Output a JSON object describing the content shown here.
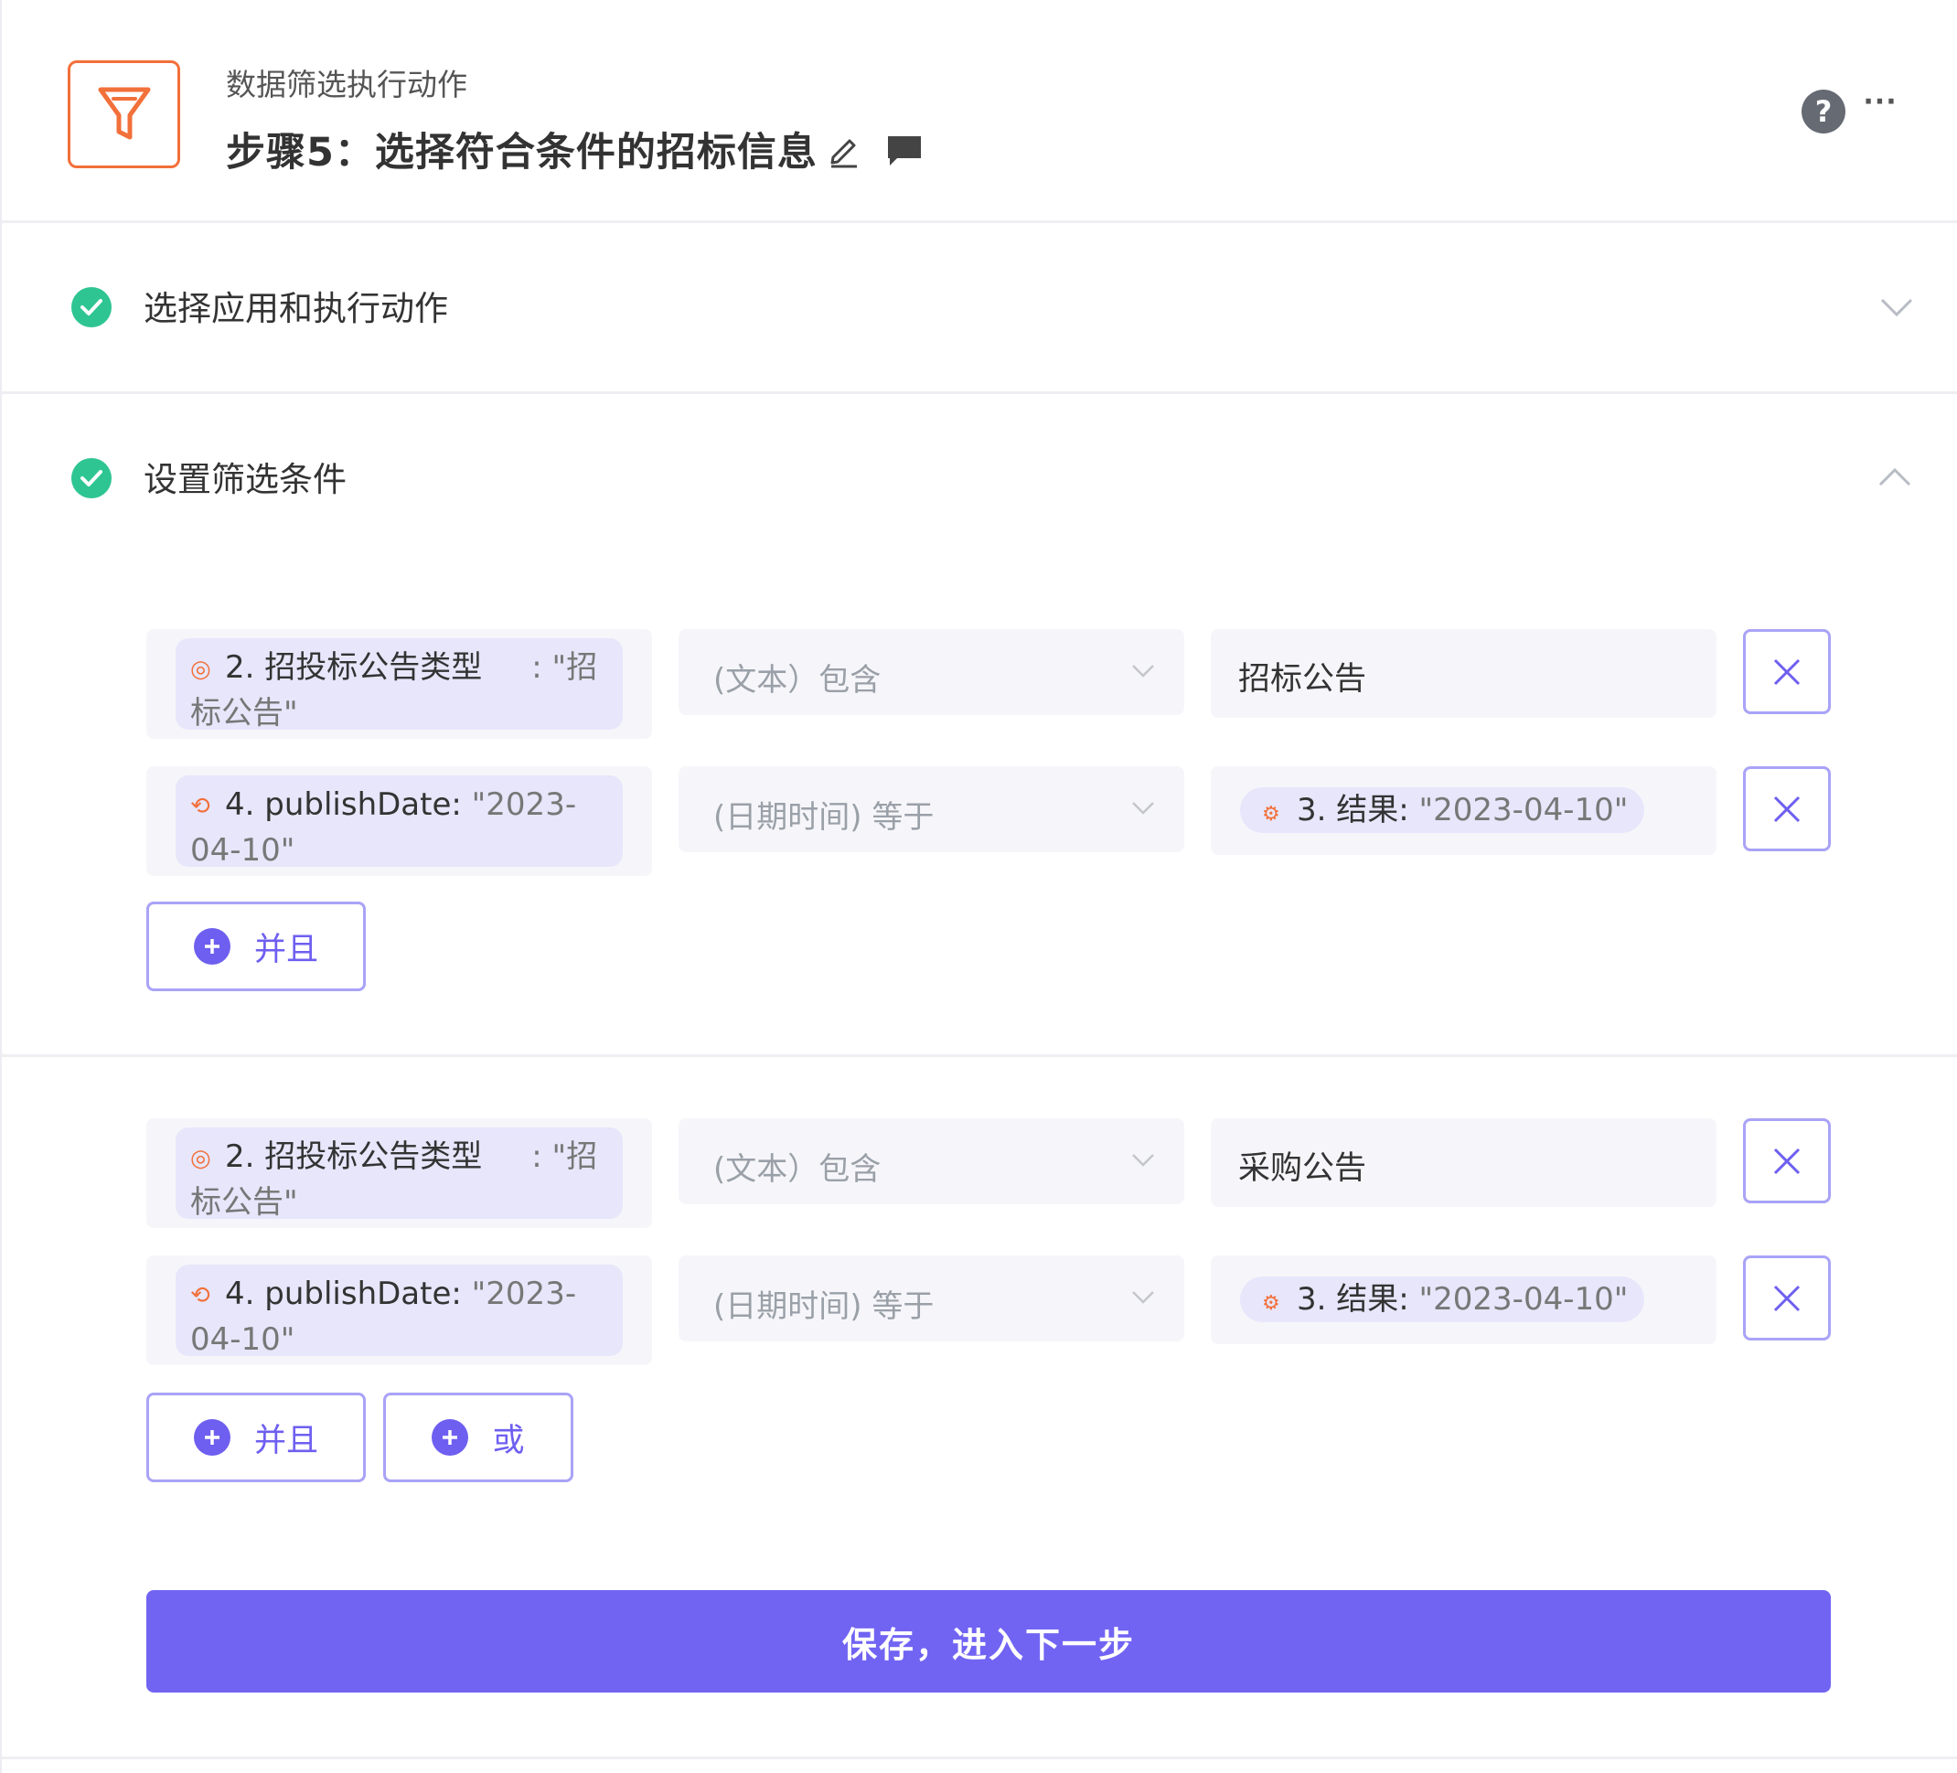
{
  "header": {
    "subtitle": "数据筛选执行动作",
    "title": "步骤5：选择符合条件的招标信息",
    "help_glyph": "?",
    "more_glyph": "···",
    "icons": {
      "app": "filter-icon",
      "edit": "pencil-icon",
      "comment": "comment-icon",
      "help": "help-icon",
      "more": "more-icon"
    },
    "colors": {
      "app_accent": "#f2703a"
    }
  },
  "sections": {
    "choose_app": {
      "title": "选择应用和执行动作",
      "status": "check-circle-icon",
      "expanded": false
    },
    "filter": {
      "title": "设置筛选条件",
      "status": "check-circle-icon",
      "expanded": true
    }
  },
  "condition_groups": [
    {
      "rows": [
        {
          "field_prefix": "2. 招投标公告类型",
          "field_suffix": "     : \"招标公告\"",
          "field_icon": "target-icon",
          "operator": "(文本）包含",
          "value_text": "招标公告"
        },
        {
          "field_prefix": "4. publishDate: ",
          "field_suffix": "\"2023-04-10\"",
          "field_icon": "loop-icon",
          "operator": "(日期时间) 等于",
          "value_chip_label": "3. 结果: ",
          "value_chip_value": "\"2023-04-10\"",
          "value_icon": "gear-icon"
        }
      ],
      "buttons": {
        "and": "并且"
      }
    },
    {
      "rows": [
        {
          "field_prefix": "2. 招投标公告类型",
          "field_suffix": "     : \"招标公告\"",
          "field_icon": "target-icon",
          "operator": "(文本）包含",
          "value_text": "采购公告"
        },
        {
          "field_prefix": "4. publishDate: ",
          "field_suffix": "\"2023-04-10\"",
          "field_icon": "loop-icon",
          "operator": "(日期时间) 等于",
          "value_chip_label": "3. 结果: ",
          "value_chip_value": "\"2023-04-10\"",
          "value_icon": "gear-icon"
        }
      ],
      "buttons": {
        "and": "并且",
        "or": "或"
      }
    }
  ],
  "save_button": "保存，进入下一步",
  "colors": {
    "primary": "#7164f3",
    "success": "#2ec592",
    "chip_bg": "#e7e6fb"
  }
}
